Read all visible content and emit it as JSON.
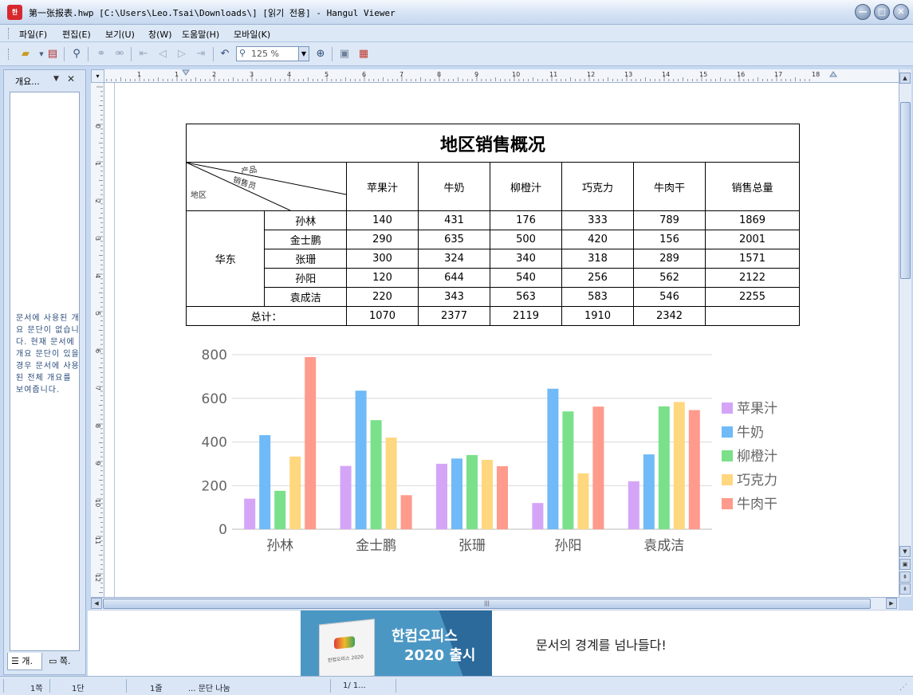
{
  "window": {
    "title": "第一张报表.hwp [C:\\Users\\Leo.Tsai\\Downloads\\] [읽기 전용] - Hangul Viewer",
    "app_icon": "한",
    "minimize": "—",
    "maximize": "□",
    "close": "✕"
  },
  "menu": [
    {
      "label": "파일(F)"
    },
    {
      "label": "편집(E)"
    },
    {
      "label": "보기(U)"
    },
    {
      "label": "창(W)"
    },
    {
      "label": "도움말(H)"
    },
    {
      "label": "모바일(K)"
    }
  ],
  "toolbar": {
    "zoom_value": "125 %",
    "icons": [
      "open-folder-icon",
      "print-icon",
      "find-icon",
      "zoom-in-icon",
      "zoom-out-icon"
    ]
  },
  "outline_panel": {
    "title": "개요...",
    "message": "문서에 사용된 개요 문단이 없습니다. 현재 문서에 개요 문단이 있을 경우 문서에 사용된 전체 개요를 보여줍니다.",
    "tab1": "개.",
    "tab2": "쪽."
  },
  "ruler": {
    "h_labels": [
      "1",
      "1",
      "2",
      "3",
      "4",
      "5",
      "6",
      "7",
      "8",
      "9",
      "10",
      "11",
      "12",
      "13",
      "14",
      "15",
      "16",
      "17",
      "18"
    ],
    "v_labels": [
      "0",
      "1",
      "2",
      "3",
      "4",
      "5",
      "6",
      "7",
      "8",
      "9",
      "10",
      "11",
      "12"
    ]
  },
  "document": {
    "table": {
      "title": "地区销售概况",
      "diag_top": "产品",
      "diag_mid": "销售员",
      "diag_bottom": "地区",
      "products": [
        "苹果汁",
        "牛奶",
        "柳橙汁",
        "巧克力",
        "牛肉干"
      ],
      "total_header": "销售总量",
      "region": "华东",
      "rows": [
        {
          "name": "孙林",
          "values": [
            "140",
            "431",
            "176",
            "333",
            "789"
          ],
          "total": "1869"
        },
        {
          "name": "金士鹏",
          "values": [
            "290",
            "635",
            "500",
            "420",
            "156"
          ],
          "total": "2001"
        },
        {
          "name": "张珊",
          "values": [
            "300",
            "324",
            "340",
            "318",
            "289"
          ],
          "total": "1571"
        },
        {
          "name": "孙阳",
          "values": [
            "120",
            "644",
            "540",
            "256",
            "562"
          ],
          "total": "2122"
        },
        {
          "name": "袁成洁",
          "values": [
            "220",
            "343",
            "563",
            "583",
            "546"
          ],
          "total": "2255"
        }
      ],
      "sum_label": "总计：",
      "sums": [
        "1070",
        "2377",
        "2119",
        "1910",
        "2342"
      ]
    }
  },
  "chart_data": {
    "type": "bar",
    "categories": [
      "孙林",
      "金士鹏",
      "张珊",
      "孙阳",
      "袁成洁"
    ],
    "series": [
      {
        "name": "苹果汁",
        "values": [
          140,
          290,
          300,
          120,
          220
        ],
        "color": "#d4a5f7"
      },
      {
        "name": "牛奶",
        "values": [
          431,
          635,
          324,
          644,
          343
        ],
        "color": "#6fbaf7"
      },
      {
        "name": "柳橙汁",
        "values": [
          176,
          500,
          340,
          540,
          563
        ],
        "color": "#7be08a"
      },
      {
        "name": "巧克力",
        "values": [
          333,
          420,
          318,
          256,
          583
        ],
        "color": "#ffd77e"
      },
      {
        "name": "牛肉干",
        "values": [
          789,
          156,
          289,
          562,
          546
        ],
        "color": "#ff9a8c"
      }
    ],
    "yticks": [
      "0",
      "200",
      "400",
      "600",
      "800"
    ],
    "ylim": [
      0,
      800
    ],
    "grid": true,
    "legend": "right"
  },
  "ad": {
    "line1": "한컴오피스",
    "line2": "2020 출시",
    "box_text": "한컴오피스 2020",
    "tagline": "문서의 경계를 넘나들다!"
  },
  "status": {
    "page": "1쪽",
    "section": "1단",
    "line": "1줄",
    "para": "... 문단 나눔",
    "count": "1/  1..."
  }
}
